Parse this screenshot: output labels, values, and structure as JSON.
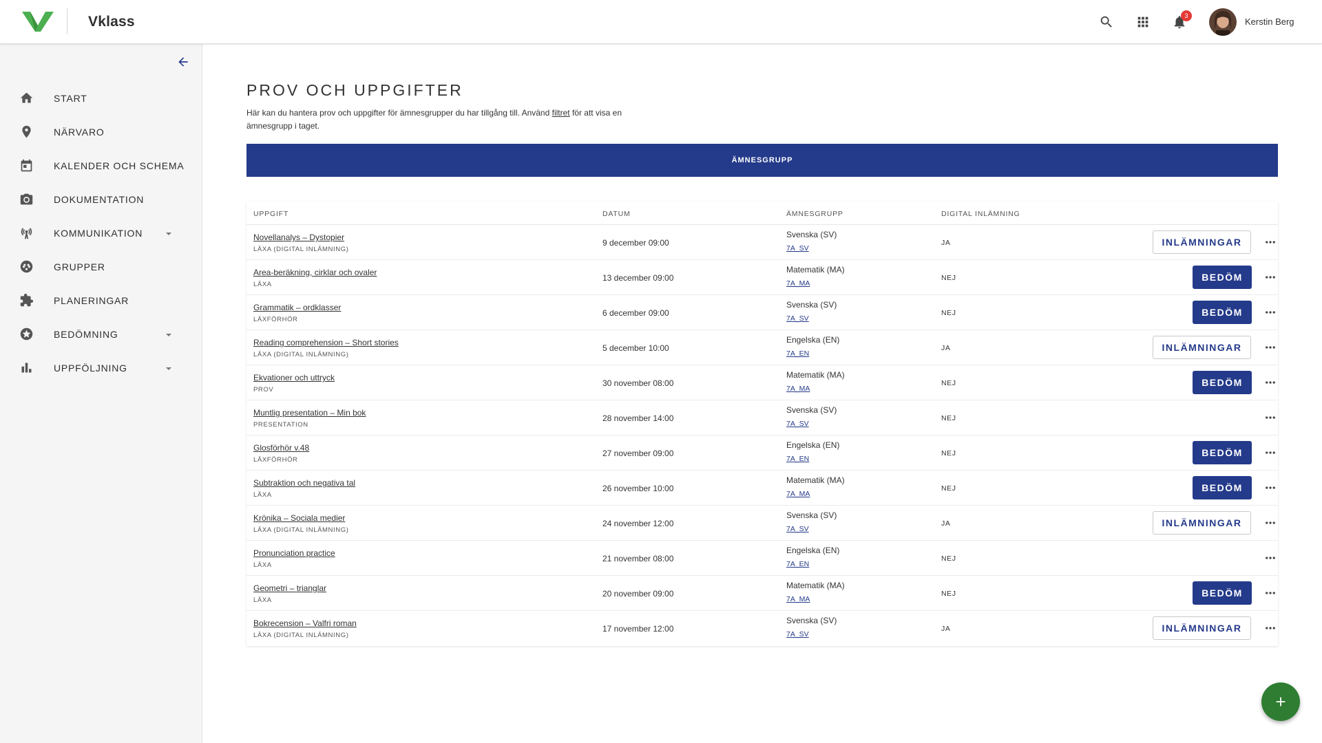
{
  "brand": {
    "name": "Vklass",
    "accent": "#243a8a",
    "logo_green": "#4caf50"
  },
  "header": {
    "icons": [
      "search-icon",
      "apps-grid-icon",
      "bell-icon"
    ],
    "notification_count": "3",
    "user_name": "Kerstin Berg"
  },
  "sidebar": {
    "items": [
      {
        "label": "START",
        "icon": "home-icon",
        "expandable": false
      },
      {
        "label": "NÄRVARO",
        "icon": "location-pin-icon",
        "expandable": false
      },
      {
        "label": "KALENDER OCH SCHEMA",
        "icon": "calendar-icon",
        "expandable": false
      },
      {
        "label": "DOKUMENTATION",
        "icon": "camera-icon",
        "expandable": false
      },
      {
        "label": "KOMMUNIKATION",
        "icon": "broadcast-icon",
        "expandable": true
      },
      {
        "label": "GRUPPER",
        "icon": "groups-icon",
        "expandable": false
      },
      {
        "label": "PLANERINGAR",
        "icon": "puzzle-icon",
        "expandable": false
      },
      {
        "label": "BEDÖMNING",
        "icon": "star-badge-icon",
        "expandable": true
      },
      {
        "label": "UPPFÖLJNING",
        "icon": "bar-chart-icon",
        "expandable": true
      }
    ]
  },
  "main": {
    "title": "PROV OCH UPPGIFTER",
    "intro_before": "Här kan du hantera prov och uppgifter för ämnesgrupper du har tillgång till. Använd ",
    "intro_link": "filtret",
    "intro_after": " för att visa en ämnesgrupp i taget.",
    "filter_label": "ÄMNESGRUPP",
    "table": {
      "headers": {
        "task": "UPPGIFT",
        "date": "DATUM",
        "group": "ÄMNESGRUPP",
        "digital": "DIGITAL INLÄMNING"
      },
      "rows": [
        {
          "title": "Novellanalys – Dystopier",
          "type": "LÄXA (DIGITAL INLÄMNING)",
          "date": "9 december 09:00",
          "group": "Svenska (SV)",
          "code": "7A_SV",
          "digital": "JA",
          "action": "INLÄMNINGAR"
        },
        {
          "title": "Area-beräkning, cirklar och ovaler",
          "type": "LÄXA",
          "date": "13 december 09:00",
          "group": "Matematik (MA)",
          "code": "7A_MA",
          "digital": "NEJ",
          "action": "BEDÖM"
        },
        {
          "title": "Grammatik – ordklasser",
          "type": "LÄXFÖRHÖR",
          "date": "6 december 09:00",
          "group": "Svenska (SV)",
          "code": "7A_SV",
          "digital": "NEJ",
          "action": "BEDÖM"
        },
        {
          "title": "Reading comprehension – Short stories",
          "type": "LÄXA (DIGITAL INLÄMNING)",
          "date": "5 december 10:00",
          "group": "Engelska (EN)",
          "code": "7A_EN",
          "digital": "JA",
          "action": "INLÄMNINGAR"
        },
        {
          "title": "Ekvationer och uttryck",
          "type": "PROV",
          "date": "30 november 08:00",
          "group": "Matematik (MA)",
          "code": "7A_MA",
          "digital": "NEJ",
          "action": "BEDÖM"
        },
        {
          "title": "Muntlig presentation – Min bok",
          "type": "PRESENTATION",
          "date": "28 november 14:00",
          "group": "Svenska (SV)",
          "code": "7A_SV",
          "digital": "NEJ",
          "action": ""
        },
        {
          "title": "Glosförhör v.48",
          "type": "LÄXFÖRHÖR",
          "date": "27 november 09:00",
          "group": "Engelska (EN)",
          "code": "7A_EN",
          "digital": "NEJ",
          "action": "BEDÖM"
        },
        {
          "title": "Subtraktion och negativa tal",
          "type": "LÄXA",
          "date": "26 november 10:00",
          "group": "Matematik (MA)",
          "code": "7A_MA",
          "digital": "NEJ",
          "action": "BEDÖM"
        },
        {
          "title": "Krönika – Sociala medier",
          "type": "LÄXA (DIGITAL INLÄMNING)",
          "date": "24 november 12:00",
          "group": "Svenska (SV)",
          "code": "7A_SV",
          "digital": "JA",
          "action": "INLÄMNINGAR"
        },
        {
          "title": "Pronunciation practice",
          "type": "LÄXA",
          "date": "21 november 08:00",
          "group": "Engelska (EN)",
          "code": "7A_EN",
          "digital": "NEJ",
          "action": ""
        },
        {
          "title": "Geometri – trianglar",
          "type": "LÄXA",
          "date": "20 november 09:00",
          "group": "Matematik (MA)",
          "code": "7A_MA",
          "digital": "NEJ",
          "action": "BEDÖM"
        },
        {
          "title": "Bokrecension – Valfri roman",
          "type": "LÄXA (DIGITAL INLÄMNING)",
          "date": "17 november 12:00",
          "group": "Svenska (SV)",
          "code": "7A_SV",
          "digital": "JA",
          "action": "INLÄMNINGAR"
        }
      ]
    }
  },
  "fab": {
    "icon": "plus-icon",
    "color": "#2e7d32"
  }
}
